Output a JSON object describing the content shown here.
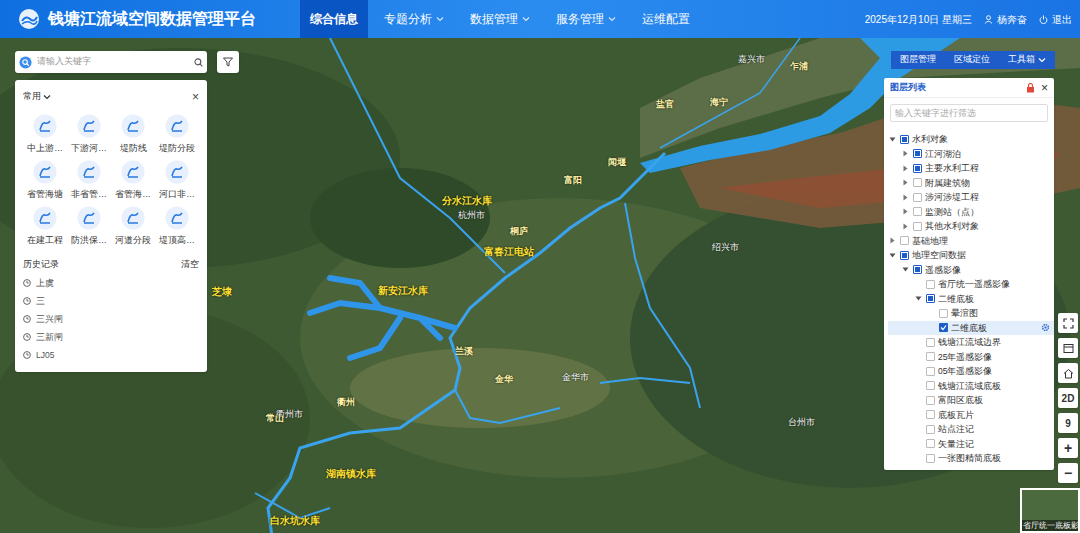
{
  "header": {
    "title": "钱塘江流域空间数据管理平台",
    "nav": [
      {
        "label": "综合信息",
        "selected": true,
        "dropdown": false
      },
      {
        "label": "专题分析",
        "selected": false,
        "dropdown": true
      },
      {
        "label": "数据管理",
        "selected": false,
        "dropdown": true
      },
      {
        "label": "服务管理",
        "selected": false,
        "dropdown": true
      },
      {
        "label": "运维配置",
        "selected": false,
        "dropdown": false
      }
    ],
    "date": "2025年12月10日 星期三",
    "user": "杨奔奋",
    "logout": "退出"
  },
  "search": {
    "placeholder": "请输入关键字"
  },
  "quick_panel": {
    "title": "常用",
    "close": "×",
    "items": [
      "中上游…",
      "下游河…",
      "堤防线",
      "堤防分段",
      "省管海塘",
      "非省管…",
      "省管海…",
      "河口非…",
      "在建工程",
      "防洪保…",
      "河道分段",
      "堤顶高…"
    ],
    "history_title": "历史记录",
    "clear": "清空",
    "history": [
      "上虞",
      "三",
      "三兴闸",
      "三新闸",
      "LJ05"
    ]
  },
  "toolbar": [
    {
      "label": "图层管理",
      "dropdown": false
    },
    {
      "label": "区域定位",
      "dropdown": false
    },
    {
      "label": "工具箱",
      "dropdown": true
    }
  ],
  "layer_panel": {
    "title": "图层列表",
    "close": "×",
    "filter_placeholder": "输入关键字进行筛选",
    "tree": [
      {
        "label": "水利对象",
        "depth": 0,
        "expandable": true,
        "expanded": true,
        "checked": false,
        "indeterminate": true,
        "selected": false
      },
      {
        "label": "江河湖泊",
        "depth": 1,
        "expandable": true,
        "expanded": false,
        "checked": false,
        "indeterminate": true,
        "selected": false
      },
      {
        "label": "主要水利工程",
        "depth": 1,
        "expandable": true,
        "expanded": false,
        "checked": false,
        "indeterminate": true,
        "selected": false
      },
      {
        "label": "附属建筑物",
        "depth": 1,
        "expandable": true,
        "expanded": false,
        "checked": false,
        "indeterminate": false,
        "selected": false
      },
      {
        "label": "涉河涉堤工程",
        "depth": 1,
        "expandable": true,
        "expanded": false,
        "checked": false,
        "indeterminate": false,
        "selected": false
      },
      {
        "label": "监测站（点）",
        "depth": 1,
        "expandable": true,
        "expanded": false,
        "checked": false,
        "indeterminate": false,
        "selected": false
      },
      {
        "label": "其他水利对象",
        "depth": 1,
        "expandable": true,
        "expanded": false,
        "checked": false,
        "indeterminate": false,
        "selected": false
      },
      {
        "label": "基础地理",
        "depth": 0,
        "expandable": true,
        "expanded": false,
        "checked": false,
        "indeterminate": false,
        "selected": false
      },
      {
        "label": "地理空间数据",
        "depth": 0,
        "expandable": true,
        "expanded": true,
        "checked": false,
        "indeterminate": true,
        "selected": false
      },
      {
        "label": "遥感影像",
        "depth": 1,
        "expandable": true,
        "expanded": true,
        "checked": false,
        "indeterminate": true,
        "selected": false
      },
      {
        "label": "省厅统一遥感影像",
        "depth": 2,
        "expandable": false,
        "expanded": false,
        "checked": false,
        "indeterminate": false,
        "selected": false
      },
      {
        "label": "二维底板",
        "depth": 2,
        "expandable": true,
        "expanded": true,
        "checked": false,
        "indeterminate": true,
        "selected": false
      },
      {
        "label": "晕渲图",
        "depth": 3,
        "expandable": false,
        "expanded": false,
        "checked": false,
        "indeterminate": false,
        "selected": false
      },
      {
        "label": "二维底板",
        "depth": 3,
        "expandable": false,
        "expanded": false,
        "checked": true,
        "indeterminate": false,
        "selected": true
      },
      {
        "label": "钱塘江流域边界",
        "depth": 2,
        "expandable": false,
        "expanded": false,
        "checked": false,
        "indeterminate": false,
        "selected": false
      },
      {
        "label": "25年遥感影像",
        "depth": 2,
        "expandable": false,
        "expanded": false,
        "checked": false,
        "indeterminate": false,
        "selected": false
      },
      {
        "label": "05年遥感影像",
        "depth": 2,
        "expandable": false,
        "expanded": false,
        "checked": false,
        "indeterminate": false,
        "selected": false
      },
      {
        "label": "钱塘江流域底板",
        "depth": 2,
        "expandable": false,
        "expanded": false,
        "checked": false,
        "indeterminate": false,
        "selected": false
      },
      {
        "label": "富阳区底板",
        "depth": 2,
        "expandable": false,
        "expanded": false,
        "checked": false,
        "indeterminate": false,
        "selected": false
      },
      {
        "label": "底板瓦片",
        "depth": 2,
        "expandable": false,
        "expanded": false,
        "checked": false,
        "indeterminate": false,
        "selected": false
      },
      {
        "label": "站点注记",
        "depth": 2,
        "expandable": false,
        "expanded": false,
        "checked": false,
        "indeterminate": false,
        "selected": false
      },
      {
        "label": "矢量注记",
        "depth": 2,
        "expandable": false,
        "expanded": false,
        "checked": false,
        "indeterminate": false,
        "selected": false
      },
      {
        "label": "一张图精简底板",
        "depth": 2,
        "expandable": false,
        "expanded": false,
        "checked": false,
        "indeterminate": false,
        "selected": false
      }
    ]
  },
  "map_controls": {
    "mode": "2D",
    "zoom": "9",
    "zoom_in": "+",
    "zoom_out": "−"
  },
  "basemap_thumb": {
    "label": "省厅统一底板影"
  },
  "map": {
    "labels": [
      {
        "text": "分水江水库",
        "kind": "reservoir"
      },
      {
        "text": "富春江电站",
        "kind": "reservoir"
      },
      {
        "text": "新安江水库",
        "kind": "reservoir"
      },
      {
        "text": "湖南镇水库",
        "kind": "reservoir"
      },
      {
        "text": "白水坑水库",
        "kind": "reservoir"
      },
      {
        "text": "芝埭",
        "kind": "reservoir"
      },
      {
        "text": "杭州市",
        "kind": "city"
      },
      {
        "text": "绍兴市",
        "kind": "city"
      },
      {
        "text": "金华市",
        "kind": "city"
      },
      {
        "text": "衢州市",
        "kind": "city"
      },
      {
        "text": "台州市",
        "kind": "city"
      },
      {
        "text": "嘉兴市",
        "kind": "city"
      },
      {
        "text": "兰溪",
        "kind": "town"
      },
      {
        "text": "金华",
        "kind": "town"
      },
      {
        "text": "常山",
        "kind": "town"
      },
      {
        "text": "衢州",
        "kind": "town"
      },
      {
        "text": "富阳",
        "kind": "town"
      },
      {
        "text": "桐庐",
        "kind": "town"
      },
      {
        "text": "闻堰",
        "kind": "town"
      },
      {
        "text": "盐官",
        "kind": "town"
      },
      {
        "text": "海宁",
        "kind": "town"
      },
      {
        "text": "乍浦",
        "kind": "town"
      }
    ]
  }
}
